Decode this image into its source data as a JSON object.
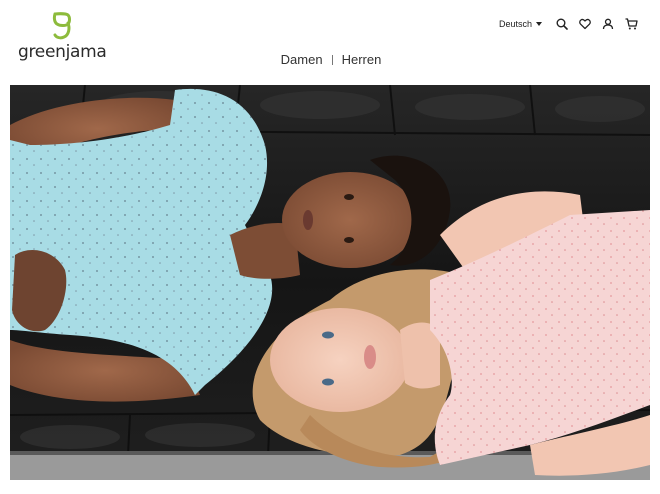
{
  "brand": {
    "name": "greenjama",
    "accent": "#8dbb3c",
    "logo_icon": "leaf-g-icon"
  },
  "header": {
    "language": "Deutsch",
    "icons": [
      "search-icon",
      "heart-icon",
      "user-icon",
      "cart-icon"
    ]
  },
  "nav": {
    "items": [
      {
        "label": "Damen"
      },
      {
        "label": "Herren"
      }
    ]
  },
  "hero": {
    "colors": {
      "sofa": "#1b1b1b",
      "shirt_left": "#a8dce5",
      "shirt_right": "#f6d5d4",
      "floor": "#9a9a9a"
    }
  }
}
